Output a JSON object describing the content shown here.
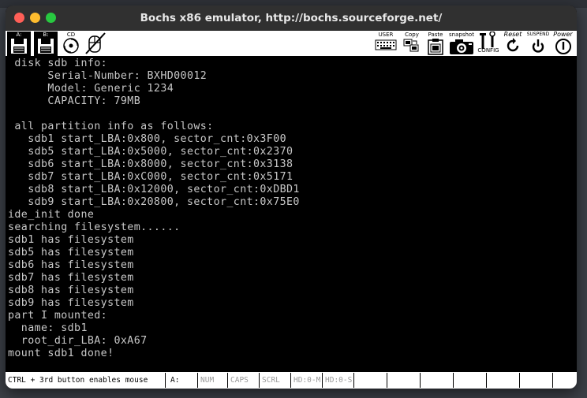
{
  "window": {
    "title": "Bochs x86 emulator, http://bochs.sourceforge.net/"
  },
  "toolbar": {
    "floppy_a": "A:",
    "floppy_b": "B:",
    "cdrom": "CD",
    "user": "USER",
    "copy": "Copy",
    "paste": "Paste",
    "snapshot": "snapshot",
    "config": "CONFIG",
    "reset": "Reset",
    "suspend": "SUSPEND",
    "power": "Power"
  },
  "console": {
    "lines": [
      " disk sdb info:",
      "      Serial-Number: BXHD00012",
      "      Model: Generic 1234",
      "      CAPACITY: 79MB",
      "",
      " all partition info as follows:",
      "   sdb1 start_LBA:0x800, sector_cnt:0x3F00",
      "   sdb5 start_LBA:0x5000, sector_cnt:0x2370",
      "   sdb6 start_LBA:0x8000, sector_cnt:0x3138",
      "   sdb7 start_LBA:0xC000, sector_cnt:0x5171",
      "   sdb8 start_LBA:0x12000, sector_cnt:0xDBD1",
      "   sdb9 start_LBA:0x20800, sector_cnt:0x75E0",
      "ide_init done",
      "searching filesystem......",
      "sdb1 has filesystem",
      "sdb5 has filesystem",
      "sdb6 has filesystem",
      "sdb7 has filesystem",
      "sdb8 has filesystem",
      "sdb9 has filesystem",
      "part I mounted:",
      "  name: sdb1",
      "  root_dir_LBA: 0xA67",
      "mount sdb1 done!"
    ]
  },
  "statusbar": {
    "hint": "CTRL + 3rd button enables mouse",
    "drive": "A:",
    "num": "NUM",
    "caps": "CAPS",
    "scrl": "SCRL",
    "hd0_master": "HD:0-M",
    "hd0_slave": "HD:0-S"
  },
  "colors": {
    "console_fg": "#c8c8c8",
    "console_bg": "#000000",
    "close": "#ff5f57",
    "minimize": "#febc2e",
    "maximize": "#28c840"
  }
}
